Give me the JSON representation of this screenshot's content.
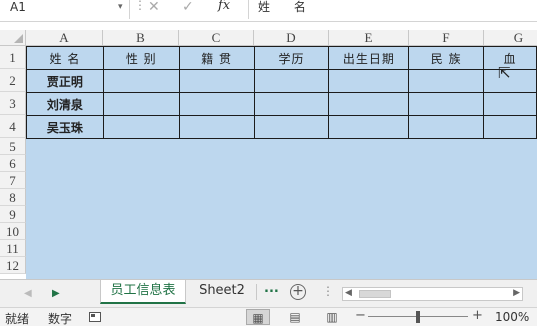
{
  "formula_bar": {
    "name_box": "A1",
    "content": "姓 名",
    "cancel_icon": "close-icon",
    "enter_icon": "check-icon",
    "function_label": "fx"
  },
  "columns": [
    "A",
    "B",
    "C",
    "D",
    "E",
    "F",
    "G"
  ],
  "rows": [
    "1",
    "2",
    "3",
    "4",
    "5",
    "6",
    "7",
    "8",
    "9",
    "10",
    "11",
    "12"
  ],
  "table": {
    "headers": [
      "姓  名",
      "性  别",
      "籍  贯",
      "学历",
      "出生日期",
      "民  族",
      "血"
    ],
    "names": [
      "贾正明",
      "刘清泉",
      "吴玉珠"
    ]
  },
  "sheet_tabs": {
    "active": "员工信息表",
    "other": "Sheet2",
    "more": "...",
    "add_icon": "plus-circle-icon"
  },
  "status_bar": {
    "ready": "就绪",
    "mode": "数字",
    "zoom_minus": "−",
    "zoom_plus": "+",
    "zoom": "100%",
    "zoom_level": 0.5
  },
  "colors": {
    "cell_fill": "#bdd7ee",
    "accent": "#217346",
    "header_bg": "#f2f2f2"
  }
}
